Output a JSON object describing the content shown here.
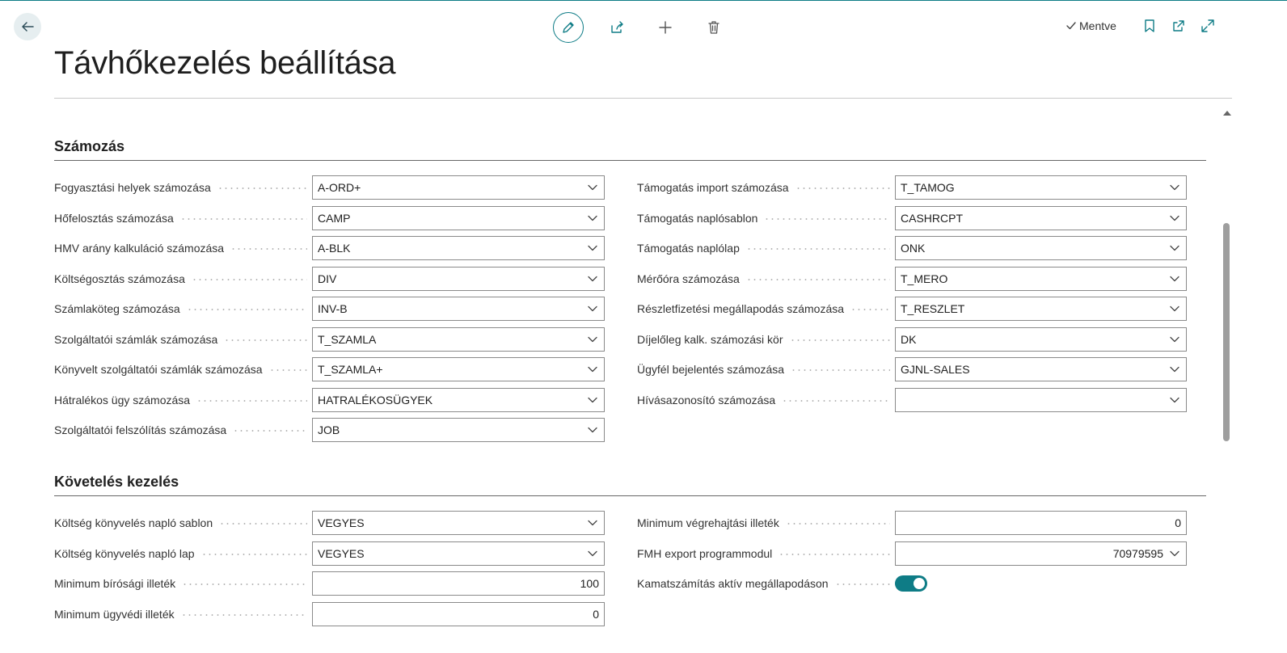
{
  "header": {
    "saved_label": "Mentve",
    "page_title": "Távhőkezelés beállítása"
  },
  "sections": [
    {
      "title": "Számozás",
      "left": [
        {
          "label": "Fogyasztási helyek számozása",
          "value": "A-ORD+",
          "kind": "select"
        },
        {
          "label": "Hőfelosztás számozása",
          "value": "CAMP",
          "kind": "select"
        },
        {
          "label": "HMV arány kalkuláció számozása",
          "value": "A-BLK",
          "kind": "select"
        },
        {
          "label": "Költségosztás számozása",
          "value": "DIV",
          "kind": "select"
        },
        {
          "label": "Számlaköteg számozása",
          "value": "INV-B",
          "kind": "select"
        },
        {
          "label": "Szolgáltatói számlák számozása",
          "value": "T_SZAMLA",
          "kind": "select"
        },
        {
          "label": "Könyvelt szolgáltatói számlák számozása",
          "value": "T_SZAMLA+",
          "kind": "select"
        },
        {
          "label": "Hátralékos ügy számozása",
          "value": "HATRALÉKOSÜGYEK",
          "kind": "select"
        },
        {
          "label": "Szolgáltatói felszólítás számozása",
          "value": "JOB",
          "kind": "select"
        }
      ],
      "right": [
        {
          "label": "Támogatás import számozása",
          "value": "T_TAMOG",
          "kind": "select"
        },
        {
          "label": "Támogatás naplósablon",
          "value": "CASHRCPT",
          "kind": "select"
        },
        {
          "label": "Támogatás naplólap",
          "value": "ONK",
          "kind": "select"
        },
        {
          "label": "Mérőóra számozása",
          "value": "T_MERO",
          "kind": "select"
        },
        {
          "label": "Részletfizetési megállapodás számozása",
          "value": "T_RESZLET",
          "kind": "select"
        },
        {
          "label": "Díjelőleg kalk. számozási kör",
          "value": "DK",
          "kind": "select"
        },
        {
          "label": "Ügyfél bejelentés számozása",
          "value": "GJNL-SALES",
          "kind": "select"
        },
        {
          "label": "Hívásazonosító számozása",
          "value": "",
          "kind": "select"
        }
      ]
    },
    {
      "title": "Követelés kezelés",
      "left": [
        {
          "label": "Költség könyvelés napló sablon",
          "value": "VEGYES",
          "kind": "select"
        },
        {
          "label": "Költség könyvelés napló lap",
          "value": "VEGYES",
          "kind": "select"
        },
        {
          "label": "Minimum bírósági illeték",
          "value": "100",
          "kind": "number"
        },
        {
          "label": "Minimum ügyvédi illeték",
          "value": "0",
          "kind": "number"
        }
      ],
      "right": [
        {
          "label": "Minimum végrehajtási illeték",
          "value": "0",
          "kind": "number"
        },
        {
          "label": "FMH export programmodul",
          "value": "70979595",
          "kind": "number-select"
        },
        {
          "label": "Kamatszámítás aktív megállapodáson",
          "value": "on",
          "kind": "toggle"
        }
      ]
    }
  ],
  "colors": {
    "accent": "#0e7c86",
    "field_border": "#8a8a8a",
    "label_text": "#333333"
  },
  "icons": [
    "back-arrow-icon",
    "edit-pencil-icon",
    "share-icon",
    "plus-icon",
    "trash-icon",
    "checkmark-icon",
    "bookmark-icon",
    "open-new-window-icon",
    "expand-icon",
    "chevron-down-icon",
    "caret-up-icon"
  ]
}
